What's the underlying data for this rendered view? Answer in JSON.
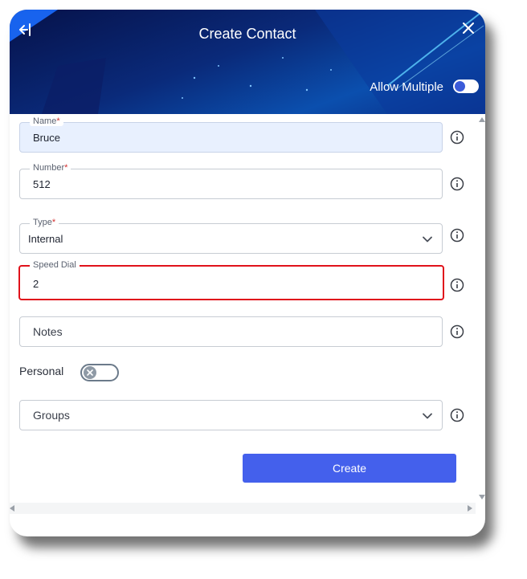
{
  "header": {
    "title": "Create Contact",
    "back_icon": "exit-left-icon",
    "close_icon": "close-icon",
    "allow_multiple_label": "Allow Multiple",
    "allow_multiple_on": false
  },
  "form": {
    "name": {
      "label": "Name",
      "required_mark": "*",
      "value": "Bruce"
    },
    "number": {
      "label": "Number",
      "required_mark": "*",
      "value": "512"
    },
    "type": {
      "label": "Type",
      "required_mark": "*",
      "value": "Internal"
    },
    "speed_dial": {
      "label": "Speed Dial",
      "value": "2"
    },
    "notes": {
      "placeholder": "Notes"
    },
    "personal": {
      "label": "Personal",
      "on": false
    },
    "groups": {
      "placeholder": "Groups"
    }
  },
  "actions": {
    "create_label": "Create"
  },
  "colors": {
    "header_dark": "#06124a",
    "header_accent": "#0b4fae",
    "primary_button": "#4460ec",
    "error_border": "#e0121b",
    "filled_field": "#e8f0fe",
    "required_mark": "#d32f2f"
  }
}
